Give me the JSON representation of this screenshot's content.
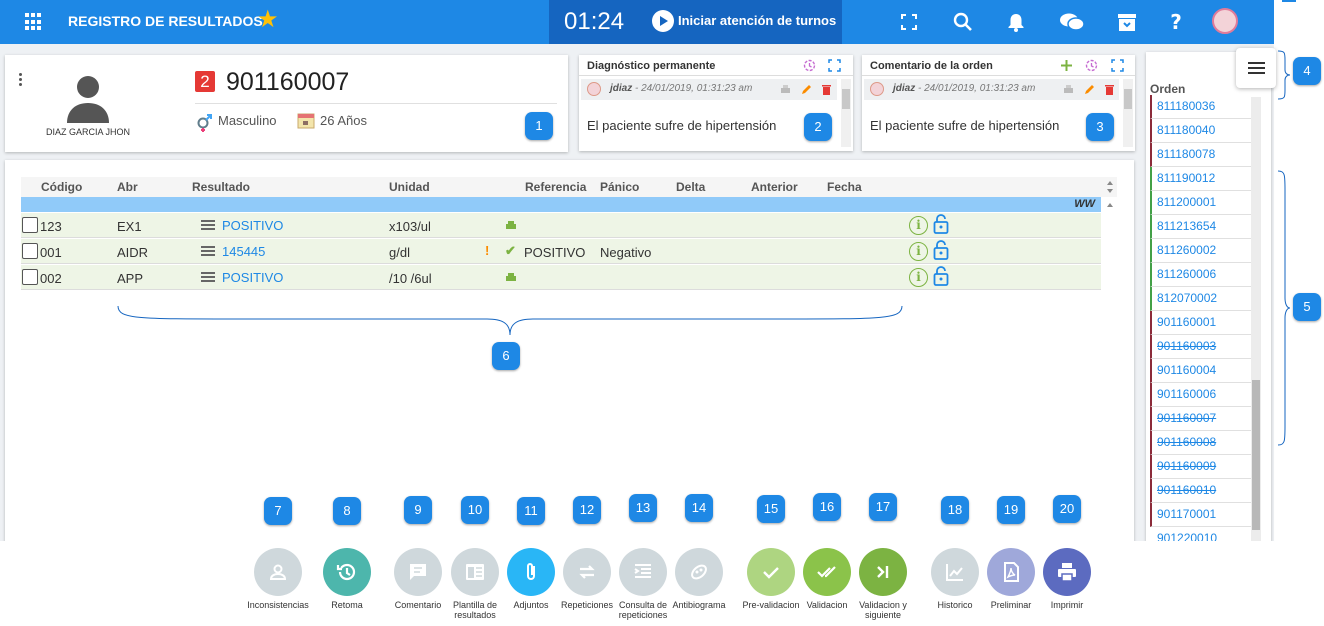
{
  "header": {
    "title": "REGISTRO DE RESULTADOS",
    "clock": "01:24",
    "turnos_label": "Iniciar atención de turnos"
  },
  "patient": {
    "name": "DIAZ GARCIA JHON",
    "badge": "2",
    "order_number": "901160007",
    "gender": "Masculino",
    "age": "26 Años"
  },
  "diagnosis_card": {
    "title": "Diagnóstico permanente",
    "user": "jdiaz",
    "timestamp": " - 24/01/2019, 01:31:23 am",
    "text": "El paciente sufre de hipertensión"
  },
  "comment_card": {
    "title": "Comentario de la orden",
    "user": "jdiaz",
    "timestamp": " - 24/01/2019, 01:31:23 am",
    "text": "El paciente sufre de hipertensión"
  },
  "table": {
    "columns": {
      "codigo": "Código",
      "abr": "Abr",
      "resultado": "Resultado",
      "unidad": "Unidad",
      "referencia": "Referencia",
      "panico": "Pánico",
      "delta": "Delta",
      "anterior": "Anterior",
      "fecha": "Fecha"
    },
    "group_label": "WW",
    "rows": [
      {
        "codigo": "123",
        "abr": "EX1",
        "resultado": "POSITIVO",
        "unidad": "x103/ul",
        "referencia": "",
        "panico": ""
      },
      {
        "codigo": "001",
        "abr": "AIDR",
        "resultado": "145445",
        "unidad": "g/dl",
        "referencia": "POSITIVO",
        "panico": "Negativo"
      },
      {
        "codigo": "002",
        "abr": "APP",
        "resultado": "POSITIVO",
        "unidad": "/10 /6ul",
        "referencia": "",
        "panico": ""
      }
    ]
  },
  "orders": {
    "title": "Orden",
    "items": [
      {
        "number": "811180036",
        "status": "red"
      },
      {
        "number": "811180040",
        "status": "red"
      },
      {
        "number": "811180078",
        "status": "red"
      },
      {
        "number": "811190012",
        "status": "green"
      },
      {
        "number": "811200001",
        "status": "green"
      },
      {
        "number": "811213654",
        "status": "green"
      },
      {
        "number": "811260002",
        "status": "green"
      },
      {
        "number": "811260006",
        "status": "green"
      },
      {
        "number": "812070002",
        "status": "green"
      },
      {
        "number": "901160001",
        "status": "red"
      },
      {
        "number": "901160003",
        "status": "red-strike"
      },
      {
        "number": "901160004",
        "status": "red"
      },
      {
        "number": "901160006",
        "status": "red"
      },
      {
        "number": "901160007",
        "status": "red-strike"
      },
      {
        "number": "901160008",
        "status": "red-strike"
      },
      {
        "number": "901160009",
        "status": "red-strike"
      },
      {
        "number": "901160010",
        "status": "red-strike"
      },
      {
        "number": "901170001",
        "status": "red"
      },
      {
        "number": "901220010",
        "status": "plain"
      }
    ]
  },
  "callouts": [
    "1",
    "2",
    "3",
    "4",
    "5",
    "6",
    "7",
    "8",
    "9",
    "10",
    "11",
    "12",
    "13",
    "14",
    "15",
    "16",
    "17",
    "18",
    "19",
    "20"
  ],
  "toolbar": {
    "buttons": [
      {
        "label": "Inconsistencias",
        "color": "#cfd8dc",
        "icon": "person-icon"
      },
      {
        "label": "Retoma",
        "color": "#4db6ac",
        "icon": "history-icon"
      },
      {
        "label": "Comentario",
        "color": "#cfd8dc",
        "icon": "comment-icon"
      },
      {
        "label": "Plantilla de resultados",
        "color": "#cfd8dc",
        "icon": "template-icon"
      },
      {
        "label": "Adjuntos",
        "color": "#29b6f6",
        "icon": "paperclip-icon"
      },
      {
        "label": "Repeticiones",
        "color": "#cfd8dc",
        "icon": "repeat-icon"
      },
      {
        "label": "Consulta de repeticiones",
        "color": "#cfd8dc",
        "icon": "list-indent-icon"
      },
      {
        "label": "Antibiograma",
        "color": "#cfd8dc",
        "icon": "bacteria-icon"
      },
      {
        "label": "Pre-validacion",
        "color": "#aed581",
        "icon": "check-icon"
      },
      {
        "label": "Validacion",
        "color": "#8bc34a",
        "icon": "double-check-icon"
      },
      {
        "label": "Validacion y siguiente",
        "color": "#7cb342",
        "icon": "skip-next-icon"
      },
      {
        "label": "Historico",
        "color": "#cfd8dc",
        "icon": "chart-line-icon"
      },
      {
        "label": "Preliminar",
        "color": "#9fa8da",
        "icon": "pdf-icon"
      },
      {
        "label": "Imprimir",
        "color": "#5c6bc0",
        "icon": "printer-icon"
      }
    ]
  }
}
